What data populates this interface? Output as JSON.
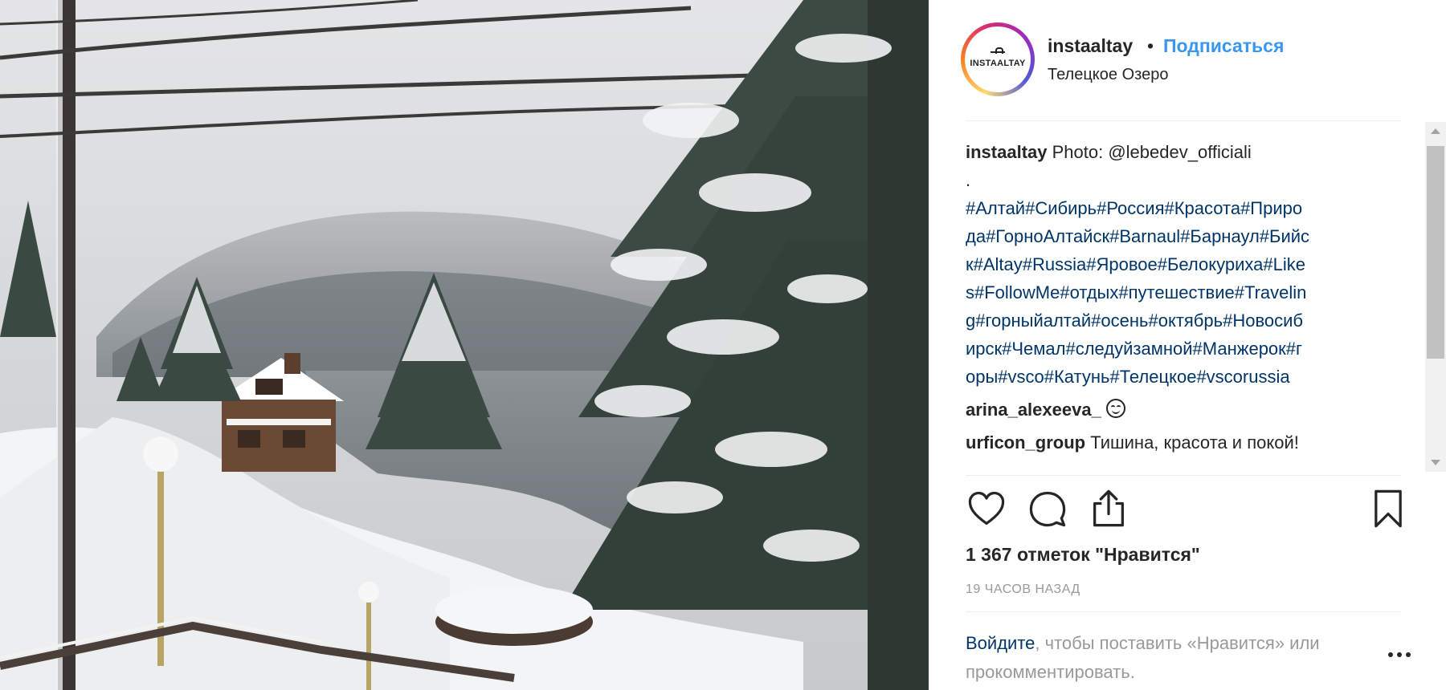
{
  "photo": {
    "alt_subject": "snow-covered-lake-landscape"
  },
  "post": {
    "avatar_text": "INSTAALTAY",
    "username": "instaaltay",
    "separator": "•",
    "follow_label": "Подписаться",
    "location": "Телецкое Озеро"
  },
  "caption": {
    "username": "instaaltay",
    "first_line": " Photo: @lebedev_officiali",
    "dot_line": ".",
    "hashtag_lines": [
      "#Алтай#Сибирь#Россия#Красота#Приро",
      "да#ГорноАлтайск#Barnaul#Барнаул#Бийс",
      "к#Altay#Russia#Яровое#Белокуриха#Like",
      "s#FollowMe#отдых#путешествие#Travelin",
      "g#горныйалтай#осень#октябрь#Новосиб",
      "ирск#Чемал#следуйзамной#Манжерок#г",
      "оры#vsco#Катунь#Телецкое#vscorussia"
    ]
  },
  "comments": [
    {
      "username": "arina_alexeeva_",
      "text": "",
      "emoji": "smiling-face"
    },
    {
      "username": "urficon_group",
      "text": " Тишина, красота и покой!",
      "emoji": ""
    }
  ],
  "likes_text": "1 367 отметок \"Нравится\"",
  "time_ago": "19 ЧАСОВ НАЗАД",
  "login_prompt": {
    "link": "Войдите",
    "text": ", чтобы поставить «Нравится» или прокомментировать."
  },
  "icons": {
    "like": "heart-icon",
    "comment": "comment-icon",
    "share": "share-icon",
    "save": "bookmark-icon",
    "more": "more-options-icon"
  },
  "colors": {
    "link": "#3897f0",
    "hashtag": "#003569",
    "muted": "#999999",
    "text": "#262626"
  }
}
